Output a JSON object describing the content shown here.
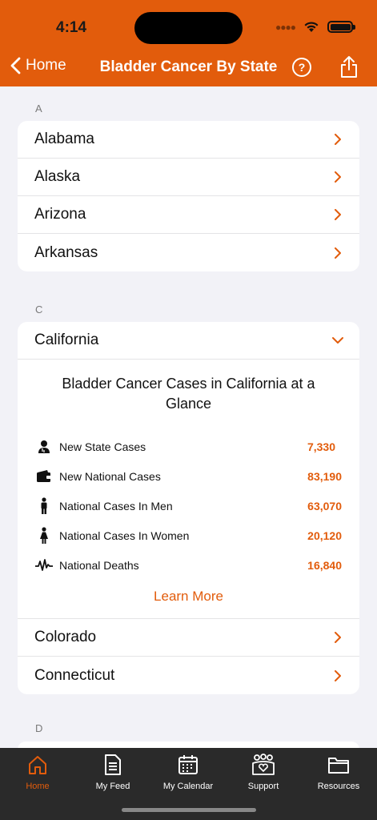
{
  "status": {
    "time": "4:14"
  },
  "nav": {
    "back_label": "Home",
    "title": "Bladder Cancer By State",
    "help": "?"
  },
  "sections": [
    {
      "letter": "A",
      "states": [
        "Alabama",
        "Alaska",
        "Arizona",
        "Arkansas"
      ]
    },
    {
      "letter": "C",
      "states": [
        "California",
        "Colorado",
        "Connecticut"
      ]
    },
    {
      "letter": "D",
      "states": []
    }
  ],
  "expanded": {
    "state": "California",
    "title": "Bladder Cancer Cases in California at a Glance",
    "stats": [
      {
        "label": "New State Cases",
        "value": "7,330",
        "icon": "doctor-icon"
      },
      {
        "label": "New National Cases",
        "value": "83,190",
        "icon": "wallet-icon"
      },
      {
        "label": "National Cases In Men",
        "value": "63,070",
        "icon": "man-icon"
      },
      {
        "label": "National Cases In Women",
        "value": "20,120",
        "icon": "woman-icon"
      },
      {
        "label": "National Deaths",
        "value": "16,840",
        "icon": "heartbeat-icon"
      }
    ],
    "learn_more": "Learn More"
  },
  "tabs": [
    {
      "label": "Home",
      "icon": "home-icon",
      "active": true
    },
    {
      "label": "My Feed",
      "icon": "document-icon",
      "active": false
    },
    {
      "label": "My Calendar",
      "icon": "calendar-icon",
      "active": false
    },
    {
      "label": "Support",
      "icon": "support-group-icon",
      "active": false
    },
    {
      "label": "Resources",
      "icon": "folder-icon",
      "active": false
    }
  ],
  "colors": {
    "accent": "#e25c0c",
    "background": "#f2f2f7",
    "tabbar": "#2a2a2a"
  }
}
